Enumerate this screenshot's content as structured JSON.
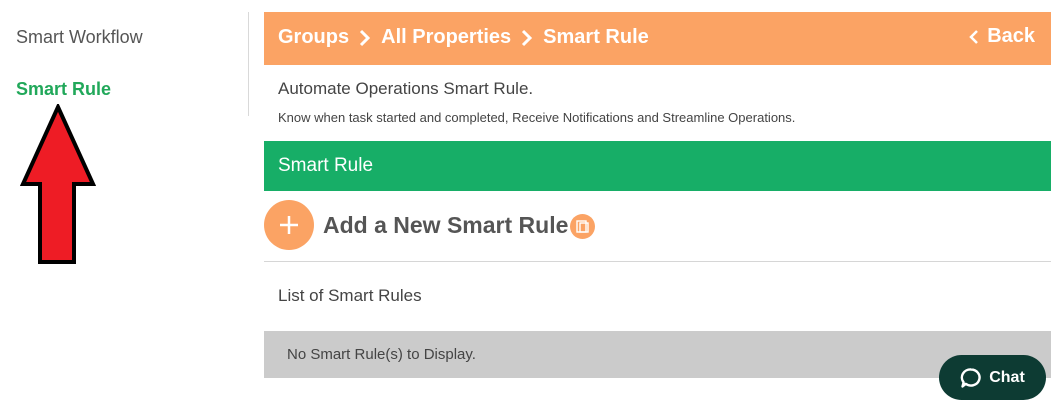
{
  "sidebar": {
    "items": [
      {
        "label": "Smart Workflow",
        "active": false
      },
      {
        "label": "Smart Rule",
        "active": true
      }
    ],
    "annotation_icon": "red-up-arrow"
  },
  "header": {
    "breadcrumbs": [
      "Groups",
      "All Properties",
      "Smart Rule"
    ],
    "back_label": "Back",
    "color": "#fba364"
  },
  "intro": {
    "title": "Automate Operations Smart Rule.",
    "subtitle": "Know when task started and completed, Receive Notifications and Streamline Operations."
  },
  "section": {
    "title": "Smart Rule",
    "color": "#17ae67"
  },
  "add_rule": {
    "label": "Add a New Smart Rule",
    "add_icon": "plus-icon",
    "info_icon": "video-icon"
  },
  "list": {
    "title": "List of Smart Rules",
    "empty_message": "No Smart Rule(s) to Display."
  },
  "chat": {
    "label": "Chat",
    "icon": "chat-bubble-icon",
    "color": "#0d3b33"
  },
  "colors": {
    "accent_orange": "#fba364",
    "accent_green": "#17ae67",
    "active_link": "#21a85a",
    "annotation_arrow": "#ee1c25"
  }
}
